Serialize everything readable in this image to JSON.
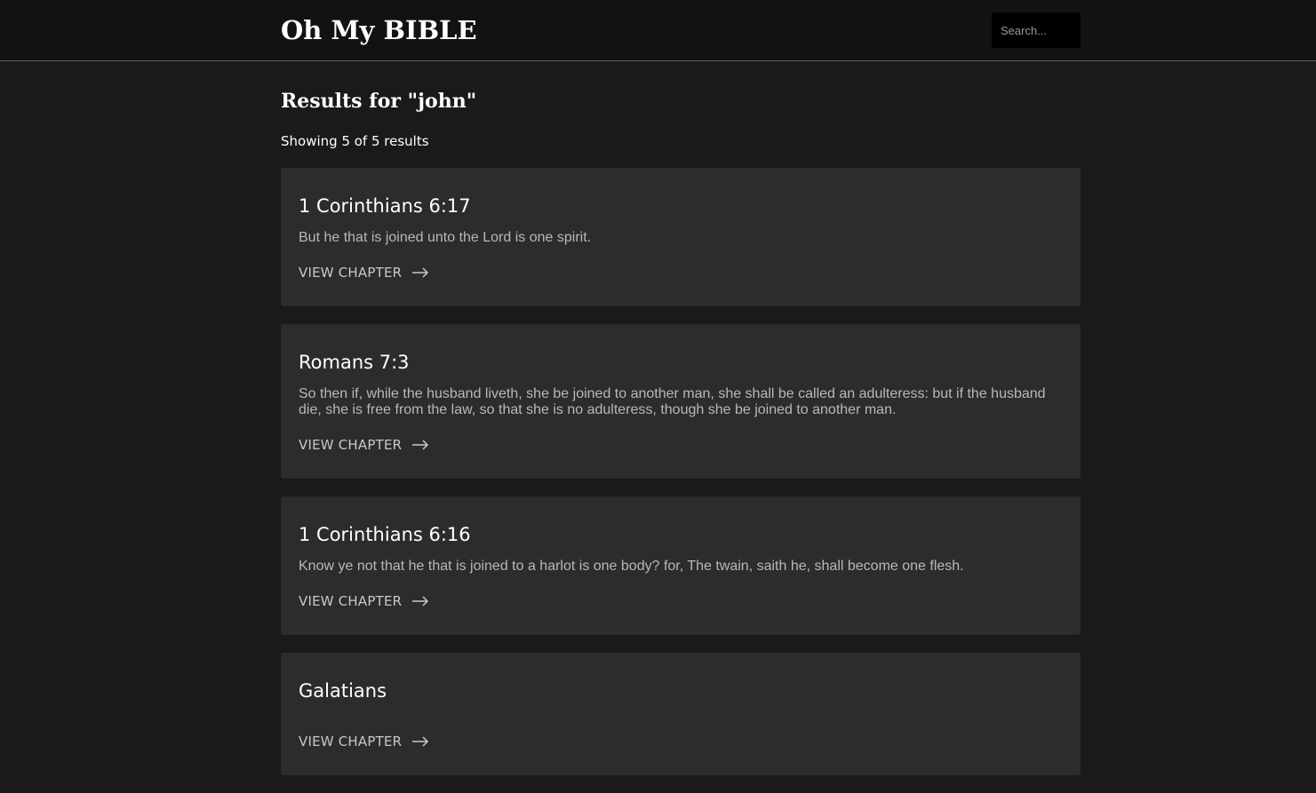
{
  "header": {
    "logo": "Oh My BIBLE",
    "search_placeholder": "Search..."
  },
  "main": {
    "results_title": "Results for \"john\"",
    "results_count": "Showing 5 of 5 results",
    "results": [
      {
        "reference": "1 Corinthians 6:17",
        "text": "But he that is joined unto the Lord is one spirit.",
        "link_label": "VIEW CHAPTER"
      },
      {
        "reference": "Romans 7:3",
        "text": "So then if, while the husband liveth, she be joined to another man, she shall be called an adulteress: but if the husband die, she is free from the law, so that she is no adulteress, though she be joined to another man.",
        "link_label": "VIEW CHAPTER"
      },
      {
        "reference": "1 Corinthians 6:16",
        "text": "Know ye not that he that is joined to a harlot is one body? for, The twain, saith he, shall become one flesh.",
        "link_label": "VIEW CHAPTER"
      },
      {
        "reference": "Galatians",
        "text": "",
        "link_label": "VIEW CHAPTER"
      }
    ]
  },
  "icons": {
    "link_arrow": "arrow-right-icon"
  },
  "colors": {
    "background": "#1a1a1a",
    "header_background": "#121212",
    "card_background": "#2c2c2c",
    "search_background": "#000000",
    "text_primary": "#ffffff",
    "text_secondary": "#b8b8b8"
  }
}
